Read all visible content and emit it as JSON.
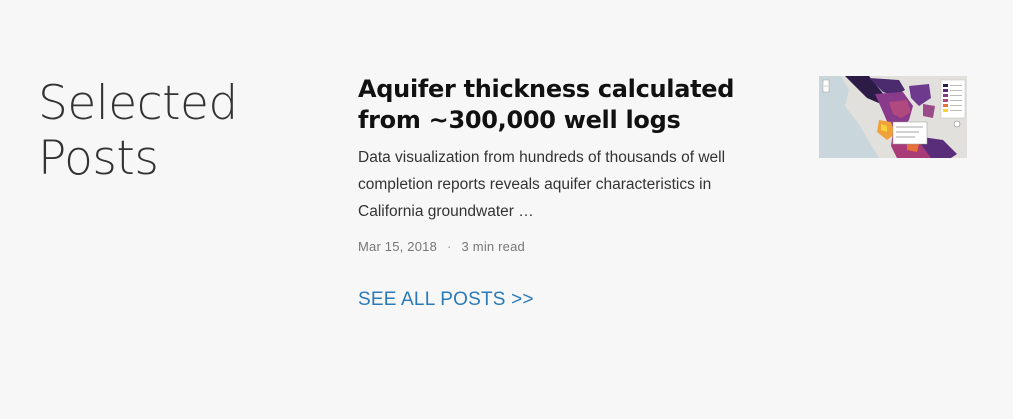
{
  "section": {
    "title": "Selected Posts"
  },
  "posts": [
    {
      "title": "Aquifer thickness calculated from ~300,000 well logs",
      "excerpt": "Data visualization from hundreds of thousands of well completion reports reveals aquifer characteristics in California groundwater …",
      "date": "Mar 15, 2018",
      "separator": "·",
      "read_time": "3 min read",
      "thumbnail_icon": "map-thumbnail"
    }
  ],
  "see_all": {
    "label": "SEE ALL POSTS >>"
  },
  "colors": {
    "background": "#f7f7f7",
    "link": "#2a7ab8",
    "title": "#111111",
    "meta": "#777777"
  }
}
